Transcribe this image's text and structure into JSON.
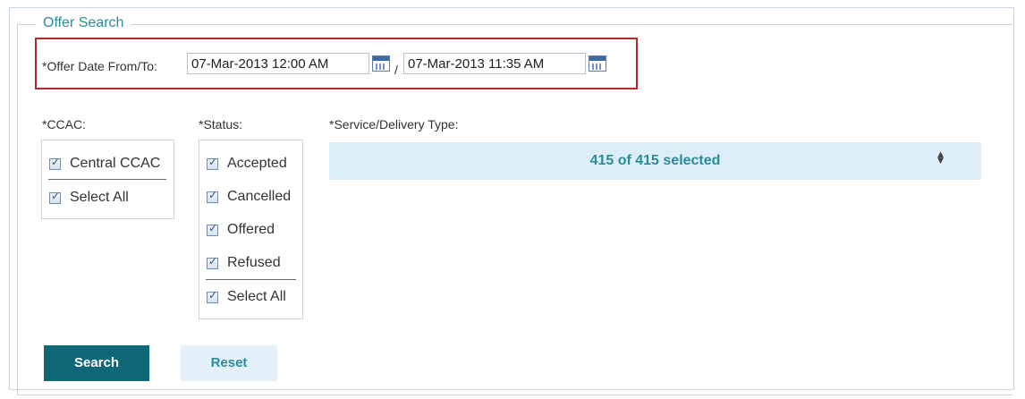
{
  "legend": "Offer Search",
  "date": {
    "label": "*Offer Date From/To:",
    "from_value": "07-Mar-2013 12:00 AM",
    "separator": "/",
    "to_value": "07-Mar-2013 11:35 AM"
  },
  "ccac": {
    "label": "*CCAC:",
    "options": [
      {
        "label": "Central CCAC",
        "checked": true
      }
    ],
    "select_all": {
      "label": "Select All",
      "checked": true
    }
  },
  "status": {
    "label": "*Status:",
    "options": [
      {
        "label": "Accepted",
        "checked": true
      },
      {
        "label": "Cancelled",
        "checked": true
      },
      {
        "label": "Offered",
        "checked": true
      },
      {
        "label": "Refused",
        "checked": true
      }
    ],
    "select_all": {
      "label": "Select All",
      "checked": true
    }
  },
  "service": {
    "label": "*Service/Delivery Type:",
    "value": "415 of 415 selected"
  },
  "buttons": {
    "search": "Search",
    "reset": "Reset"
  },
  "colors": {
    "accent": "#2a8c9b",
    "primary_button": "#0f6776",
    "highlight_border": "#b3272e",
    "select_background": "#ddeef9"
  }
}
